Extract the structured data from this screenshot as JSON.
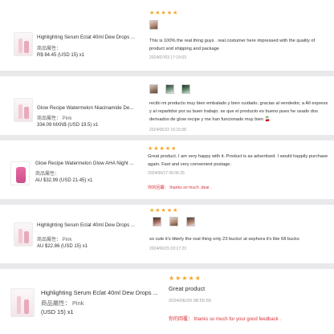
{
  "star_glyphs": "★★★★★",
  "colors": {
    "star": "#f6a623",
    "reply": "#d8343a",
    "divider": "#e9e9ec"
  },
  "reviews": [
    {
      "product_title": "Highlighting Serum Eclat 40ml Dew Drops ...",
      "attribute": "商品屬性：",
      "price": "R$ 84.45  (USD  15)  x1",
      "stars": 5,
      "text": "This is 100% the real thing guys . real costumer here impressed with the quality of product and shipping and package",
      "date": "2024/07/03 17:19:03"
    },
    {
      "product_title": "Glow Recipe Watermelon Niacinamide De...",
      "attribute": "商品屬性：  Pink",
      "price": "334.09 MXN$  (USD  19.5)  x1",
      "stars": 5,
      "text": "recibi mi producto muy bien embalado y bien cuidado, gracias al vendedor, a All express y al repartidor por su buen trabajo. se que el producto es bueno pues he usado dos derivados de glow recipe y me han funcionado muy bien 🍒",
      "date": "2024/05/22 16:15:58"
    },
    {
      "product_title": "Glow Recipe Watermelon Glow AHA Night ...",
      "attribute": "商品屬性：",
      "price": "AU $32.99  (USD  21.45)  x1",
      "stars": 5,
      "text": "Great product. I am very happy with it. Product is as advertised. I would happily purchase again. Fast and very convenient postage.",
      "date": "2024/06/17 06:06:35",
      "reply": "你的回覆：  thanks so much ,dear ."
    },
    {
      "product_title": "Highlighting Serum Eclat 40ml Dew Drops ...",
      "attribute": "商品屬性：  Pink",
      "price": "AU $22.86  (USD  15)  x1",
      "stars": 5,
      "text": "so cute it's litterly the real thing only 23 bucks! at sephora it's like 68 bucks",
      "date": "2024/06/15 03:17:23"
    },
    {
      "product_title": "Highlighting Serum Eclat 40ml Dew Drops ...",
      "attribute": "商品屬性：  Pink",
      "price": "(USD  15)  x1",
      "stars": 5,
      "text": "Great product",
      "date": "2024/06/20 08:55:55",
      "reply": "你的回覆：  thanks so much for your good feedback ."
    }
  ]
}
